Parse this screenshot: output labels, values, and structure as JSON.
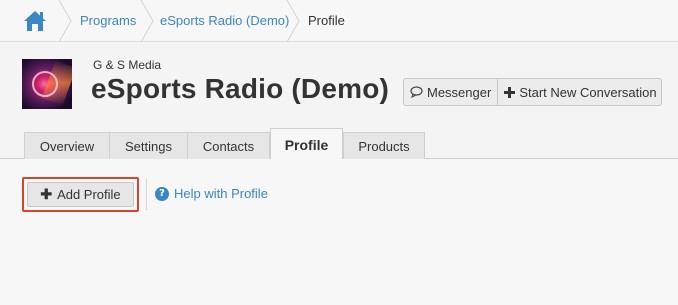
{
  "breadcrumb": {
    "home_icon": "home-icon",
    "items": [
      {
        "label": "Programs"
      },
      {
        "label": "eSports Radio (Demo)"
      },
      {
        "label": "Profile"
      }
    ]
  },
  "header": {
    "company": "G & S Media",
    "title": "eSports Radio (Demo)",
    "buttons": {
      "messenger": "Messenger",
      "new_conversation": "Start New Conversation"
    }
  },
  "tabs": [
    {
      "label": "Overview"
    },
    {
      "label": "Settings"
    },
    {
      "label": "Contacts"
    },
    {
      "label": "Profile",
      "active": true
    },
    {
      "label": "Products"
    }
  ],
  "content": {
    "add_profile": "Add Profile",
    "help": "Help with Profile"
  },
  "colors": {
    "link": "#3b86c4",
    "highlight": "#d9442f"
  }
}
